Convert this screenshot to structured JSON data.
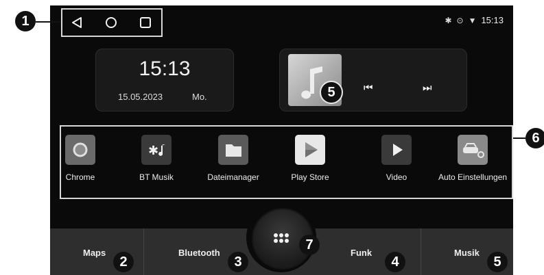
{
  "status_bar": {
    "time": "15:13",
    "icons": [
      "bluetooth-icon",
      "location-icon",
      "wifi-icon"
    ]
  },
  "clock_widget": {
    "time": "15:13",
    "date": "15.05.2023",
    "day": "Mo."
  },
  "media_widget": {
    "prev_label": "⏮",
    "next_label": "⏭"
  },
  "apps": [
    {
      "label": "Chrome"
    },
    {
      "label": "BT Musik"
    },
    {
      "label": "Dateimanager"
    },
    {
      "label": "Play Store"
    },
    {
      "label": "Video"
    },
    {
      "label": "Auto Einstellungen"
    }
  ],
  "dock": [
    {
      "label": "Maps"
    },
    {
      "label": "Bluetooth"
    },
    {
      "label": "Funk"
    },
    {
      "label": "Musik"
    }
  ],
  "callouts": {
    "nav": "1",
    "maps": "2",
    "bluetooth": "3",
    "funk": "4",
    "musik": "5",
    "media": "5",
    "apps": "6",
    "center": "7"
  }
}
